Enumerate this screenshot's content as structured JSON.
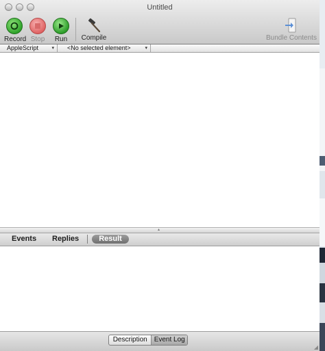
{
  "window": {
    "title": "Untitled"
  },
  "toolbar": {
    "record_label": "Record",
    "stop_label": "Stop",
    "run_label": "Run",
    "compile_label": "Compile",
    "bundle_label": "Bundle Contents"
  },
  "navbar": {
    "language": "AppleScript",
    "element": "<No selected element>"
  },
  "log_tabs": {
    "events": "Events",
    "replies": "Replies",
    "result": "Result"
  },
  "bottom_tabs": {
    "description": "Description",
    "event_log": "Event Log"
  },
  "colors": {
    "record": "#2fa32a",
    "stop": "#e06464",
    "run": "#2e9d2b"
  },
  "icons": {
    "record": "record-icon",
    "stop": "stop-icon",
    "run": "play-icon",
    "compile": "hammer-icon",
    "bundle": "bundle-icon"
  }
}
